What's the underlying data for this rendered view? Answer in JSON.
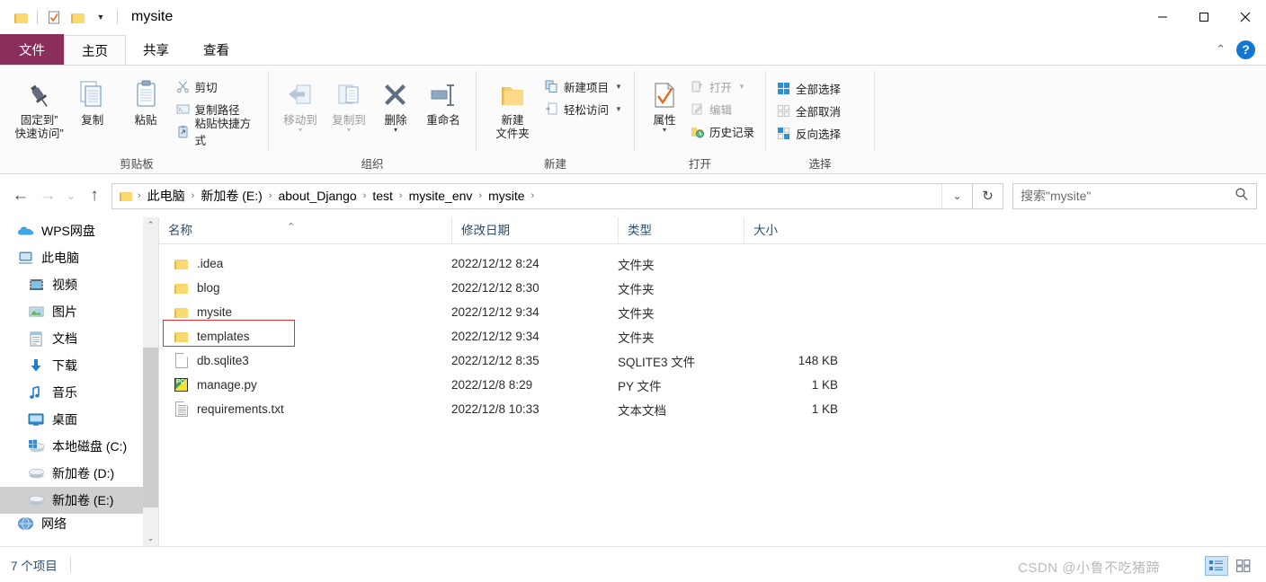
{
  "window": {
    "title": "mysite",
    "quick_access": [
      {
        "name": "folder-icon",
        "label": "folder"
      },
      {
        "name": "properties-check-icon",
        "label": "properties"
      },
      {
        "name": "new-folder-icon",
        "label": "new folder"
      },
      {
        "name": "customize-qat-dropdown",
        "label": "▾"
      }
    ],
    "controls": {
      "minimize": "—",
      "maximize": "☐",
      "close": "✕"
    }
  },
  "ribbon": {
    "tabs": [
      {
        "label": "文件",
        "active": false,
        "is_file_tab": true
      },
      {
        "label": "主页",
        "active": true
      },
      {
        "label": "共享",
        "active": false
      },
      {
        "label": "查看",
        "active": false
      }
    ],
    "collapse_icon": "⌃",
    "help_label": "?",
    "groups": [
      {
        "label": "剪贴板",
        "big": [
          {
            "label": "固定到\"\n快速访问\"",
            "line1": "固定到”",
            "line2": "快速访问”",
            "icon": "pin-icon"
          },
          {
            "label": "复制",
            "line1": "复制",
            "line2": "",
            "icon": "copy-icon"
          },
          {
            "label": "粘贴",
            "line1": "粘贴",
            "line2": "",
            "icon": "paste-icon"
          }
        ],
        "small": [
          {
            "label": "剪切",
            "icon": "scissors-icon",
            "disabled": false
          },
          {
            "label": "复制路径",
            "icon": "copy-path-icon",
            "disabled": false
          },
          {
            "label": "粘贴快捷方式",
            "icon": "paste-shortcut-icon",
            "disabled": false
          }
        ]
      },
      {
        "label": "组织",
        "big": [
          {
            "label": "移动到",
            "line1": "移动到",
            "line2": "",
            "icon": "move-to-icon",
            "caret": true,
            "disabled": true
          },
          {
            "label": "复制到",
            "line1": "复制到",
            "line2": "",
            "icon": "copy-to-icon",
            "caret": true,
            "disabled": true
          },
          {
            "label": "删除",
            "line1": "删除",
            "line2": "",
            "icon": "delete-icon",
            "caret": true
          },
          {
            "label": "重命名",
            "line1": "重命名",
            "line2": "",
            "icon": "rename-icon"
          }
        ],
        "small": []
      },
      {
        "label": "新建",
        "big": [
          {
            "label": "新建\n文件夹",
            "line1": "新建",
            "line2": "文件夹",
            "icon": "new-folder-icon"
          }
        ],
        "small": [
          {
            "label": "新建项目",
            "icon": "new-item-icon",
            "caret": true
          },
          {
            "label": "轻松访问",
            "icon": "easy-access-icon",
            "caret": true
          }
        ]
      },
      {
        "label": "打开",
        "big": [
          {
            "label": "属性",
            "line1": "属性",
            "line2": "",
            "icon": "properties-icon",
            "caret": true
          }
        ],
        "small": [
          {
            "label": "打开",
            "icon": "open-icon",
            "caret": true,
            "disabled": true
          },
          {
            "label": "编辑",
            "icon": "edit-icon",
            "disabled": true
          },
          {
            "label": "历史记录",
            "icon": "history-icon"
          }
        ]
      },
      {
        "label": "选择",
        "big": [],
        "small": [
          {
            "label": "全部选择",
            "icon": "select-all-icon"
          },
          {
            "label": "全部取消",
            "icon": "select-none-icon"
          },
          {
            "label": "反向选择",
            "icon": "invert-selection-icon"
          }
        ]
      }
    ]
  },
  "addressbar": {
    "back_icon": "←",
    "forward_icon": "→",
    "recent_icon": "⌄",
    "up_icon": "↑",
    "folder_icon": "folder-icon",
    "breadcrumbs": [
      "此电脑",
      "新加卷 (E:)",
      "about_Django",
      "test",
      "mysite_env",
      "mysite"
    ],
    "separator": "›",
    "dropdown_icon": "⌄",
    "refresh_icon": "↻"
  },
  "search": {
    "placeholder": "搜索\"mysite\"",
    "icon": "search-icon"
  },
  "sidebar": {
    "items": [
      {
        "label": "WPS网盘",
        "icon": "cloud-icon",
        "level": 0,
        "selected": false
      },
      {
        "label": "此电脑",
        "icon": "this-pc-icon",
        "level": 0,
        "selected": false
      },
      {
        "label": "视频",
        "icon": "videos-icon",
        "level": 1,
        "selected": false
      },
      {
        "label": "图片",
        "icon": "pictures-icon",
        "level": 1,
        "selected": false
      },
      {
        "label": "文档",
        "icon": "documents-icon",
        "level": 1,
        "selected": false
      },
      {
        "label": "下载",
        "icon": "downloads-icon",
        "level": 1,
        "selected": false
      },
      {
        "label": "音乐",
        "icon": "music-icon",
        "level": 1,
        "selected": false
      },
      {
        "label": "桌面",
        "icon": "desktop-icon",
        "level": 1,
        "selected": false
      },
      {
        "label": "本地磁盘 (C:)",
        "icon": "windows-drive-icon",
        "level": 1,
        "selected": false
      },
      {
        "label": "新加卷 (D:)",
        "icon": "drive-icon",
        "level": 1,
        "selected": false
      },
      {
        "label": "新加卷 (E:)",
        "icon": "drive-icon",
        "level": 1,
        "selected": true
      },
      {
        "label": "网络",
        "icon": "network-icon",
        "level": 0,
        "selected": false
      }
    ],
    "scroll_up_icon": "⌃",
    "scroll_down_icon": "⌄"
  },
  "filelist": {
    "columns": [
      {
        "label": "名称",
        "key": "name",
        "sorted": "asc"
      },
      {
        "label": "修改日期",
        "key": "date"
      },
      {
        "label": "类型",
        "key": "type"
      },
      {
        "label": "大小",
        "key": "size"
      }
    ],
    "sort_indicator": "⌃",
    "rows": [
      {
        "name": ".idea",
        "date": "2022/12/12 8:24",
        "type": "文件夹",
        "size": "",
        "icon": "folder-icon",
        "highlighted": false
      },
      {
        "name": "blog",
        "date": "2022/12/12 8:30",
        "type": "文件夹",
        "size": "",
        "icon": "folder-icon",
        "highlighted": false
      },
      {
        "name": "mysite",
        "date": "2022/12/12 9:34",
        "type": "文件夹",
        "size": "",
        "icon": "folder-icon",
        "highlighted": false
      },
      {
        "name": "templates",
        "date": "2022/12/12 9:34",
        "type": "文件夹",
        "size": "",
        "icon": "folder-icon",
        "highlighted": true
      },
      {
        "name": "db.sqlite3",
        "date": "2022/12/12 8:35",
        "type": "SQLITE3 文件",
        "size": "148 KB",
        "icon": "generic-file-icon",
        "highlighted": false
      },
      {
        "name": "manage.py",
        "date": "2022/12/8 8:29",
        "type": "PY 文件",
        "size": "1 KB",
        "icon": "python-file-icon",
        "highlighted": false
      },
      {
        "name": "requirements.txt",
        "date": "2022/12/8 10:33",
        "type": "文本文档",
        "size": "1 KB",
        "icon": "text-file-icon",
        "highlighted": false
      }
    ]
  },
  "statusbar": {
    "item_count": "7 个项目",
    "watermark": "CSDN @小鲁不吃猪蹄",
    "views": [
      {
        "name": "details-view-button",
        "active": true
      },
      {
        "name": "large-icons-view-button",
        "active": false
      }
    ]
  },
  "colors": {
    "file_tab": "#8a2f5c",
    "highlight_box": "#e03131",
    "selection": "#cfcfcf",
    "header_text": "#2a4d6e"
  }
}
